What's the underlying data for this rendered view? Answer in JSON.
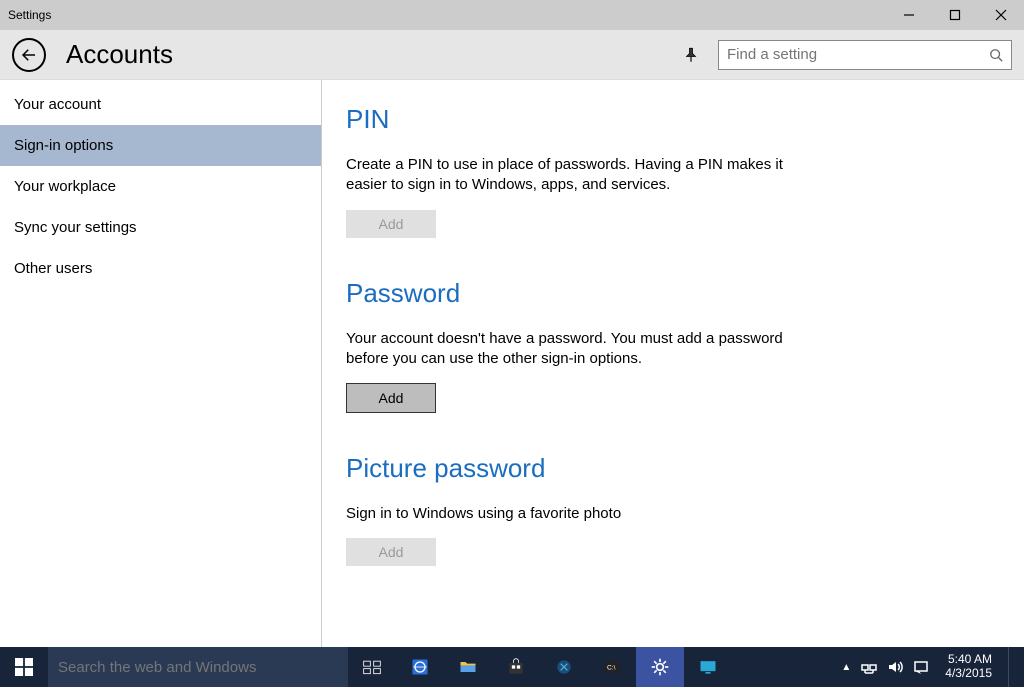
{
  "window": {
    "title": "Settings"
  },
  "header": {
    "title": "Accounts",
    "search_placeholder": "Find a setting"
  },
  "sidebar": {
    "items": [
      {
        "label": "Your account"
      },
      {
        "label": "Sign-in options"
      },
      {
        "label": "Your workplace"
      },
      {
        "label": "Sync your settings"
      },
      {
        "label": "Other users"
      }
    ]
  },
  "content": {
    "pin": {
      "heading": "PIN",
      "body": "Create a PIN to use in place of passwords. Having a PIN makes it easier to sign in to Windows, apps, and services.",
      "button": "Add"
    },
    "password": {
      "heading": "Password",
      "body": "Your account doesn't have a password. You must add a password before you can use the other sign-in options.",
      "button": "Add"
    },
    "picture": {
      "heading": "Picture password",
      "body": "Sign in to Windows using a favorite photo",
      "button": "Add"
    }
  },
  "taskbar": {
    "search_placeholder": "Search the web and Windows",
    "time": "5:40 AM",
    "date": "4/3/2015"
  }
}
